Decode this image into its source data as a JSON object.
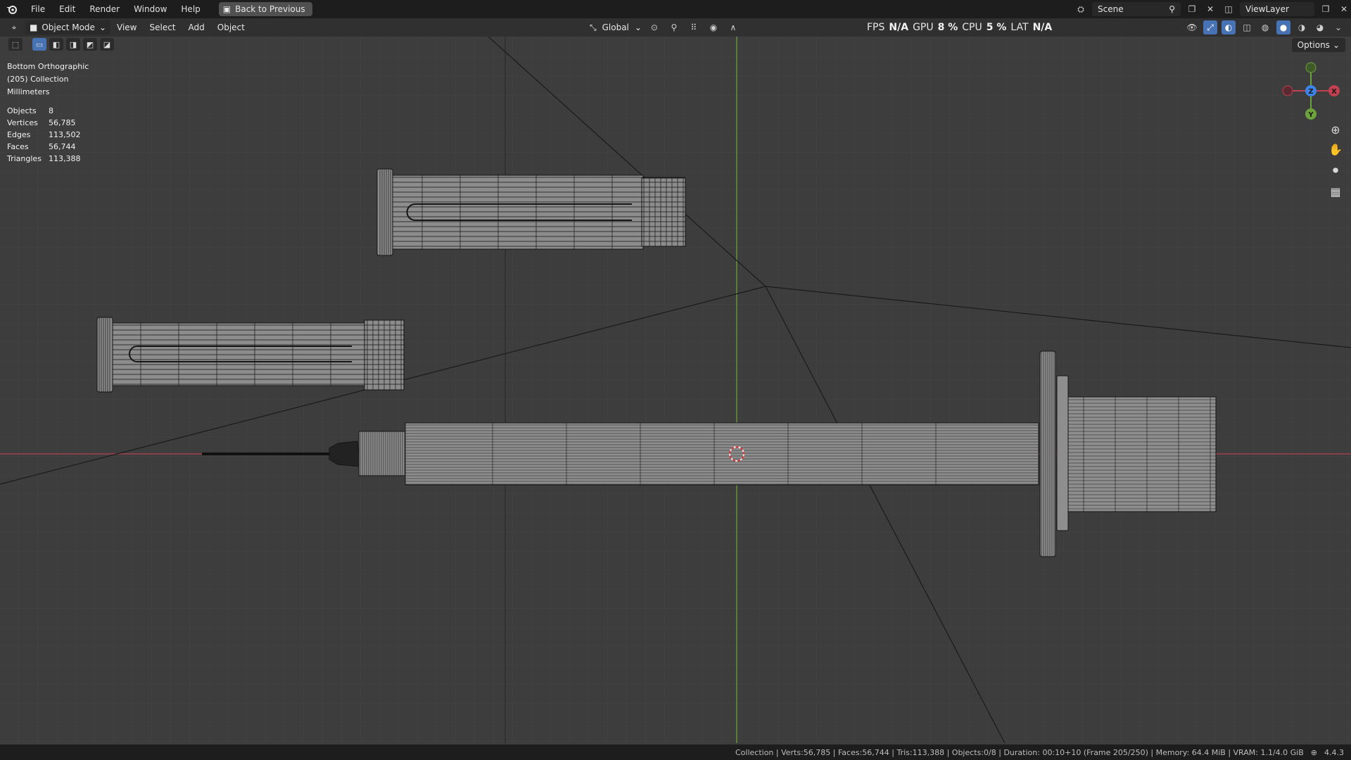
{
  "menubar": {
    "items": [
      "File",
      "Edit",
      "Render",
      "Window",
      "Help"
    ],
    "back_button": "Back to Previous",
    "scene_field": "Scene",
    "viewlayer_field": "ViewLayer"
  },
  "header": {
    "mode": "Object Mode",
    "menus": [
      "View",
      "Select",
      "Add",
      "Object"
    ],
    "transform_orientation": "Global",
    "perf": {
      "fps_label": "FPS",
      "fps_value": "N/A",
      "gpu_label": "GPU",
      "gpu_value": "8 %",
      "cpu_label": "CPU",
      "cpu_value": "5 %",
      "lat_label": "LAT",
      "lat_value": "N/A"
    },
    "options_label": "Options"
  },
  "viewport": {
    "view_name": "Bottom Orthographic",
    "collection": "(205) Collection",
    "units": "Millimeters",
    "stats": [
      {
        "label": "Objects",
        "value": "8"
      },
      {
        "label": "Vertices",
        "value": "56,785"
      },
      {
        "label": "Edges",
        "value": "113,502"
      },
      {
        "label": "Faces",
        "value": "56,744"
      },
      {
        "label": "Triangles",
        "value": "113,388"
      }
    ],
    "gizmo": {
      "x_label": "X",
      "y_label": "Y",
      "z_label": "Z"
    }
  },
  "statusbar": {
    "text": "Collection | Verts:56,785 | Faces:56,744 | Tris:113,388 | Objects:0/8 | Duration: 00:10+10 (Frame 205/250) | Memory: 64.4 MiB | VRAM: 1.1/4.0 GiB",
    "version": "4.4.3"
  },
  "colors": {
    "x_axis": "#c2404f",
    "y_axis": "#6ca33a",
    "z_axis": "#3d84e8",
    "accent": "#4772b3"
  }
}
